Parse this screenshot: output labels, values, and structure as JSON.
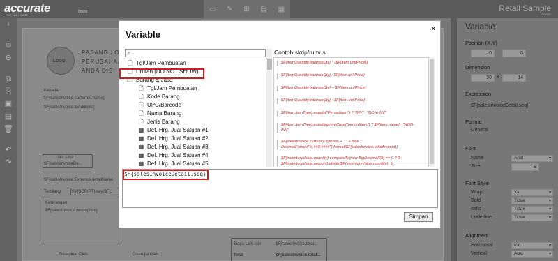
{
  "app": {
    "logo": "accurate",
    "logo_sub": "VCILLINCE",
    "logo_online": "online",
    "title": "Retail Sample",
    "subtitle": "Alvian"
  },
  "left_tools": [
    "+",
    "⊕",
    "⊖",
    "⧉",
    "⎘",
    "▣",
    "▤",
    "🗑",
    "↶",
    "↷"
  ],
  "toolbar_icons": [
    "save-icon",
    "edit-icon",
    "add-icon",
    "preview-icon",
    "print-icon"
  ],
  "sheet": {
    "company_line1": "PASANG LO",
    "company_line2": "PERUSAHAA",
    "company_line3": "ANDA DISI",
    "logo_text": "LOGO",
    "kepada": "Kepada",
    "customer_name": "$F{salesInvoice.customer.name}",
    "to_address": "$F{salesInvoice.toAddress}",
    "no_urut": "No. Urut",
    "invoice_de": "$F{salesInvoiceDe...",
    "expense_detail": "$F{salesInvoice.Expense.detailName",
    "terbilang": "Terbilang",
    "terbilang_value": "$V{SCRIPT}.say($F...",
    "keterangan": "Keterangan",
    "description": "$F{salesInvoice.description}",
    "disiapkan": "Disiapkan Oleh",
    "disetujui": "Disetujui Oleh",
    "biaya_lain": "Biaya Lain-lain",
    "biaya_value": "$F{salesInvoice.total...",
    "total": "Total",
    "total_value": "$F{salesInvoice.total..."
  },
  "panel": {
    "title": "Variable",
    "position_label": "Position (X,Y)",
    "pos_x": "0",
    "pos_y": "0",
    "dimension_label": "Dimension",
    "dim_w": "90",
    "dim_x": "x",
    "dim_h": "14",
    "expression_label": "Expression",
    "expression_value": "$F{salesInvoiceDetail.seq}",
    "format_label": "Format",
    "format_value": "General",
    "font_label": "Font",
    "font_name_label": "Name",
    "font_name": "Arial",
    "font_size_label": "Size",
    "font_size": "8",
    "font_style_label": "Font Style",
    "wrap_label": "Wrap",
    "wrap": "Ya",
    "bold_label": "Bold",
    "bold": "Tidak",
    "italic_label": "Italic",
    "italic": "Tidak",
    "underline_label": "Underline",
    "underline": "Tidak",
    "alignment_label": "Alignment",
    "horizontal_label": "Horizontal",
    "horizontal": "Kiri",
    "vertical_label": "Vertical",
    "vertical": "Atas"
  },
  "dialog": {
    "title": "Variable",
    "close": "×",
    "tree": [
      {
        "label": "Tgl/Jam Pembuatan",
        "icon": "doc",
        "indent": 0
      },
      {
        "label": "Urutan (DO NOT SHOW)",
        "icon": "doc",
        "indent": 0
      },
      {
        "label": "Barang & Jasa",
        "icon": "folder",
        "indent": 0
      },
      {
        "label": "Tgl/Jam Pembuatan",
        "icon": "doc",
        "indent": 1
      },
      {
        "label": "Kode Barang",
        "icon": "doc",
        "indent": 1
      },
      {
        "label": "UPC/Barcode",
        "icon": "doc",
        "indent": 1
      },
      {
        "label": "Nama Barang",
        "icon": "doc",
        "indent": 1
      },
      {
        "label": "Jenis Barang",
        "icon": "doc",
        "indent": 1
      },
      {
        "label": "Def. Hrg. Jual Satuan #1",
        "icon": "calc",
        "indent": 1
      },
      {
        "label": "Def. Hrg. Jual Satuan #2",
        "icon": "calc",
        "indent": 1
      },
      {
        "label": "Def. Hrg. Jual Satuan #3",
        "icon": "calc",
        "indent": 1
      },
      {
        "label": "Def. Hrg. Jual Satuan #4",
        "icon": "calc",
        "indent": 1
      },
      {
        "label": "Def. Hrg. Jual Satuan #5",
        "icon": "calc",
        "indent": 1
      }
    ],
    "examples_title": "Contoh skrip/rumus:",
    "examples": [
      "$F{itemQuantity.balanceQty} * ($F{item.unitPrice})",
      "$F{itemQuantity.balanceQty} / $F{item.unitPrice}",
      "$F{itemQuantity.balanceQty} + $F{item.unitPrice}",
      "$F{itemQuantity.balanceQty} - $F{item.unitPrice}",
      "$F{item.itemType}.equals(\"Persediaan\") ? \"INV\" : \"NON-INV\"",
      "$F{item.itemType}.equalsIgnoreCase(\"persediaan\") ? $F{item.name} : \"NON-INV\"",
      "$F{salesInvoice.currency.symbol} + \" \" + new DecimalFormat(\"#,##0.####\").format($F{salesInvoice.totalAmount})",
      "$F{inventoryValue.quantity}.compareTo(new BigDecimal(0)) == 0 ? 0 : $F{inventoryValue.amount}.divide($F{inventoryValue.quantity}, 6, RoundingMode.DOWN)"
    ],
    "editor_text": "$F{salesInvoiceDetail.seq}",
    "save_label": "Simpan"
  }
}
